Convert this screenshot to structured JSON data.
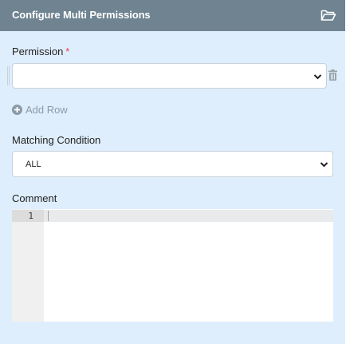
{
  "panel": {
    "title": "Configure Multi Permissions",
    "header_icon": "folder-open-icon"
  },
  "permission": {
    "label": "Permission",
    "required_mark": "*",
    "selected_value": "",
    "row_actions": {
      "drag_icon": "drag-handle-icon",
      "delete_icon": "trash-icon"
    }
  },
  "add_row": {
    "icon": "plus-circle-icon",
    "label": "Add Row"
  },
  "matching_condition": {
    "label": "Matching Condition",
    "selected_value": "ALL"
  },
  "comment": {
    "label": "Comment",
    "line_numbers": [
      "1"
    ],
    "text": ""
  },
  "colors": {
    "header_bg": "#6f8391",
    "panel_bg": "#dfeefc",
    "required": "#e0424b",
    "muted": "#8b9aa6"
  }
}
